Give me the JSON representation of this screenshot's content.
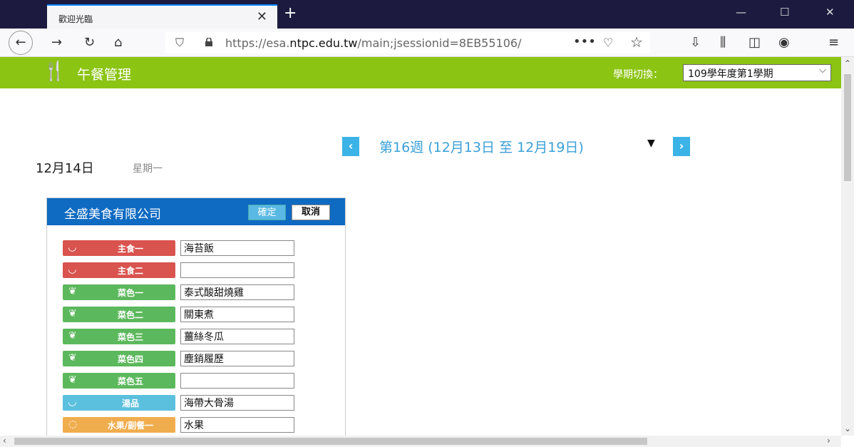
{
  "browser": {
    "tab_title": "歡迎光臨",
    "tab_close": "✕",
    "new_tab": "+",
    "win_min": "—",
    "win_max": "☐",
    "win_close": "✕",
    "url_prefix": "https://esa.",
    "url_domain": "ntpc.edu.tw",
    "url_path": "/main;jsessionid=8EB55106/",
    "url_more": "•••"
  },
  "app": {
    "title": "午餐管理",
    "semester_label": "學期切換：",
    "semester_value": "109學年度第1學期"
  },
  "week": {
    "prev": "‹",
    "label": "第16週 (12月13日 至 12月19日)",
    "next": "›"
  },
  "day": {
    "date": "12月14日",
    "weekday": "星期一"
  },
  "vendor": {
    "name": "全盛美食有限公司",
    "confirm": "確定",
    "cancel": "取消"
  },
  "dishes": [
    {
      "category": "主食一",
      "value": "海苔飯",
      "color": "#d9534f",
      "icon": "rice-bowl-icon"
    },
    {
      "category": "主食二",
      "value": "",
      "color": "#d9534f",
      "icon": "rice-bowl-icon"
    },
    {
      "category": "菜色一",
      "value": "泰式酸甜燒雞",
      "color": "#5cb85c",
      "icon": "vegetable-icon"
    },
    {
      "category": "菜色二",
      "value": "關東煮",
      "color": "#5cb85c",
      "icon": "vegetable-icon"
    },
    {
      "category": "菜色三",
      "value": "薑絲冬瓜",
      "color": "#5cb85c",
      "icon": "vegetable-icon"
    },
    {
      "category": "菜色四",
      "value": "塵銷履歷",
      "color": "#5cb85c",
      "icon": "vegetable-icon"
    },
    {
      "category": "菜色五",
      "value": "",
      "color": "#5cb85c",
      "icon": "vegetable-icon"
    },
    {
      "category": "湯品",
      "value": "海帶大骨湯",
      "color": "#5bc0de",
      "icon": "soup-bowl-icon"
    },
    {
      "category": "水果/副餐一",
      "value": "水果",
      "color": "#f0ad4e",
      "icon": "fruit-icon"
    }
  ]
}
